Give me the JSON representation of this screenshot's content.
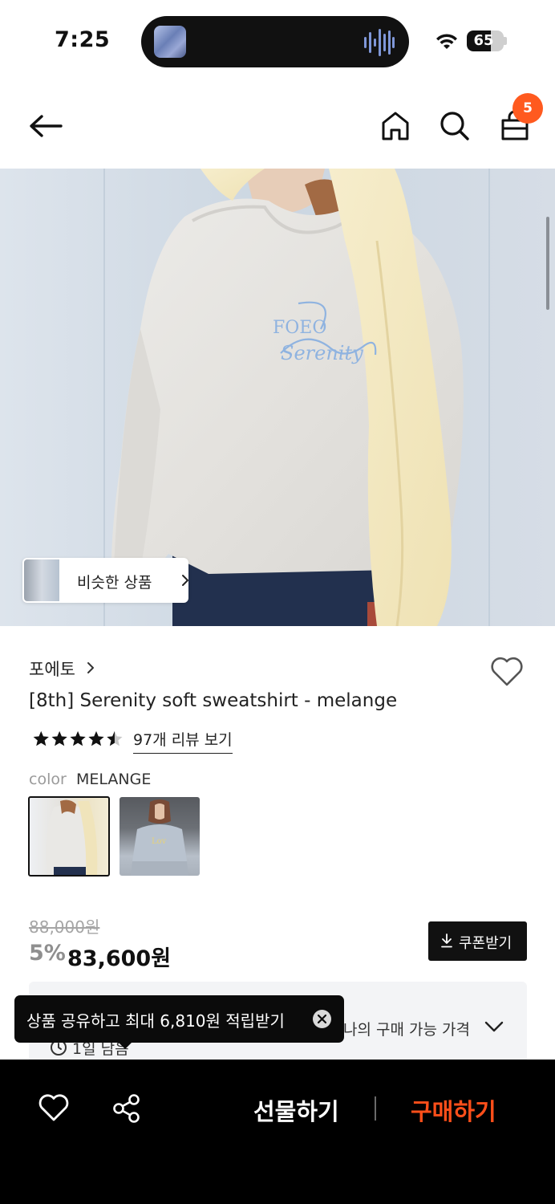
{
  "status_bar": {
    "time": "7:25",
    "battery": "65",
    "battery_level": 0.65,
    "icons": [
      "now-playing-thumbnail",
      "audio-waveform-icon",
      "wifi-icon",
      "battery-icon"
    ]
  },
  "nav": {
    "icons": [
      "back-arrow-icon",
      "home-icon",
      "search-icon",
      "shopping-bag-icon"
    ],
    "cart_count": "5"
  },
  "hero": {
    "similar_products_label": "비슷한 상품",
    "print_text": "FOETO Serenity"
  },
  "product": {
    "brand": "포에토",
    "title": "[8th] Serenity soft sweatshirt - melange",
    "rating": 4.5,
    "review_link": "97개 리뷰 보기",
    "color_label": "color",
    "color_value": "MELANGE",
    "swatches": [
      "melange",
      "gray"
    ],
    "original_price": "88,000원",
    "discount_rate": "5%",
    "sale_price": "83,600원",
    "coupon_label": "쿠폰받기",
    "my_price_label": "나의 구매 가능 가격",
    "timer_text": "1일 남음"
  },
  "toast": {
    "text": "상품 공유하고 최대 6,810원 적립받기"
  },
  "bottom_bar": {
    "icons": [
      "heart-icon",
      "share-icon"
    ],
    "gift_label": "선물하기",
    "buy_label": "구매하기"
  },
  "colors": {
    "accent": "#ff5a1f",
    "buy": "#ff4f1a",
    "dark": "#111111"
  }
}
